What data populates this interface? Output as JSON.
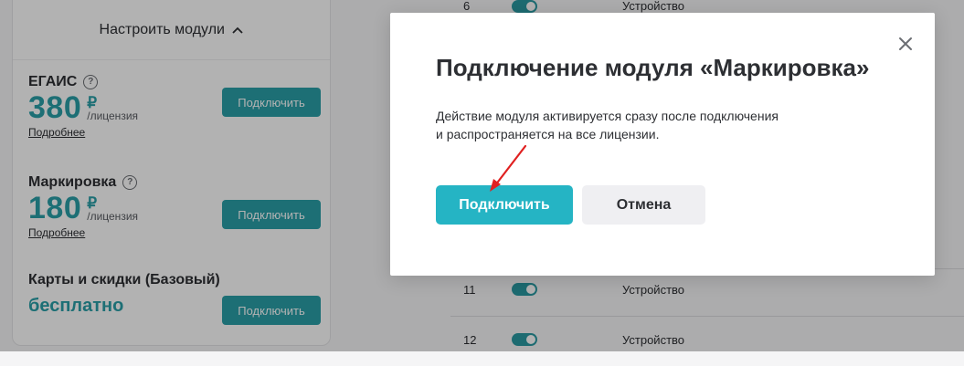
{
  "modules_panel": {
    "configure_label": "Настроить модули",
    "modules": [
      {
        "name": "ЕГАИС",
        "price": "380",
        "currency": "₽",
        "per": "/лицензия",
        "more": "Подробнее",
        "button": "Подключить"
      },
      {
        "name": "Маркировка",
        "price": "180",
        "currency": "₽",
        "per": "/лицензия",
        "more": "Подробнее",
        "button": "Подключить"
      },
      {
        "name": "Карты и скидки (Базовый)",
        "price_text": "бесплатно",
        "button": "Подключить"
      }
    ]
  },
  "device_table": {
    "rows": [
      {
        "num": "6",
        "type": "Устройство"
      },
      {
        "num": "11",
        "type": "Устройство"
      },
      {
        "num": "12",
        "type": "Устройство"
      }
    ]
  },
  "modal": {
    "title": "Подключение модуля «Маркировка»",
    "text_line1": "Действие модуля активируется сразу после подключения",
    "text_line2": "и распространяется на все лицензии.",
    "confirm_label": "Подключить",
    "cancel_label": "Отмена",
    "close_icon": "close-icon"
  },
  "annotation": {
    "arrow_color": "#e02020"
  },
  "colors": {
    "accent": "#2aa0a8",
    "primary_button": "#25b4c4"
  }
}
